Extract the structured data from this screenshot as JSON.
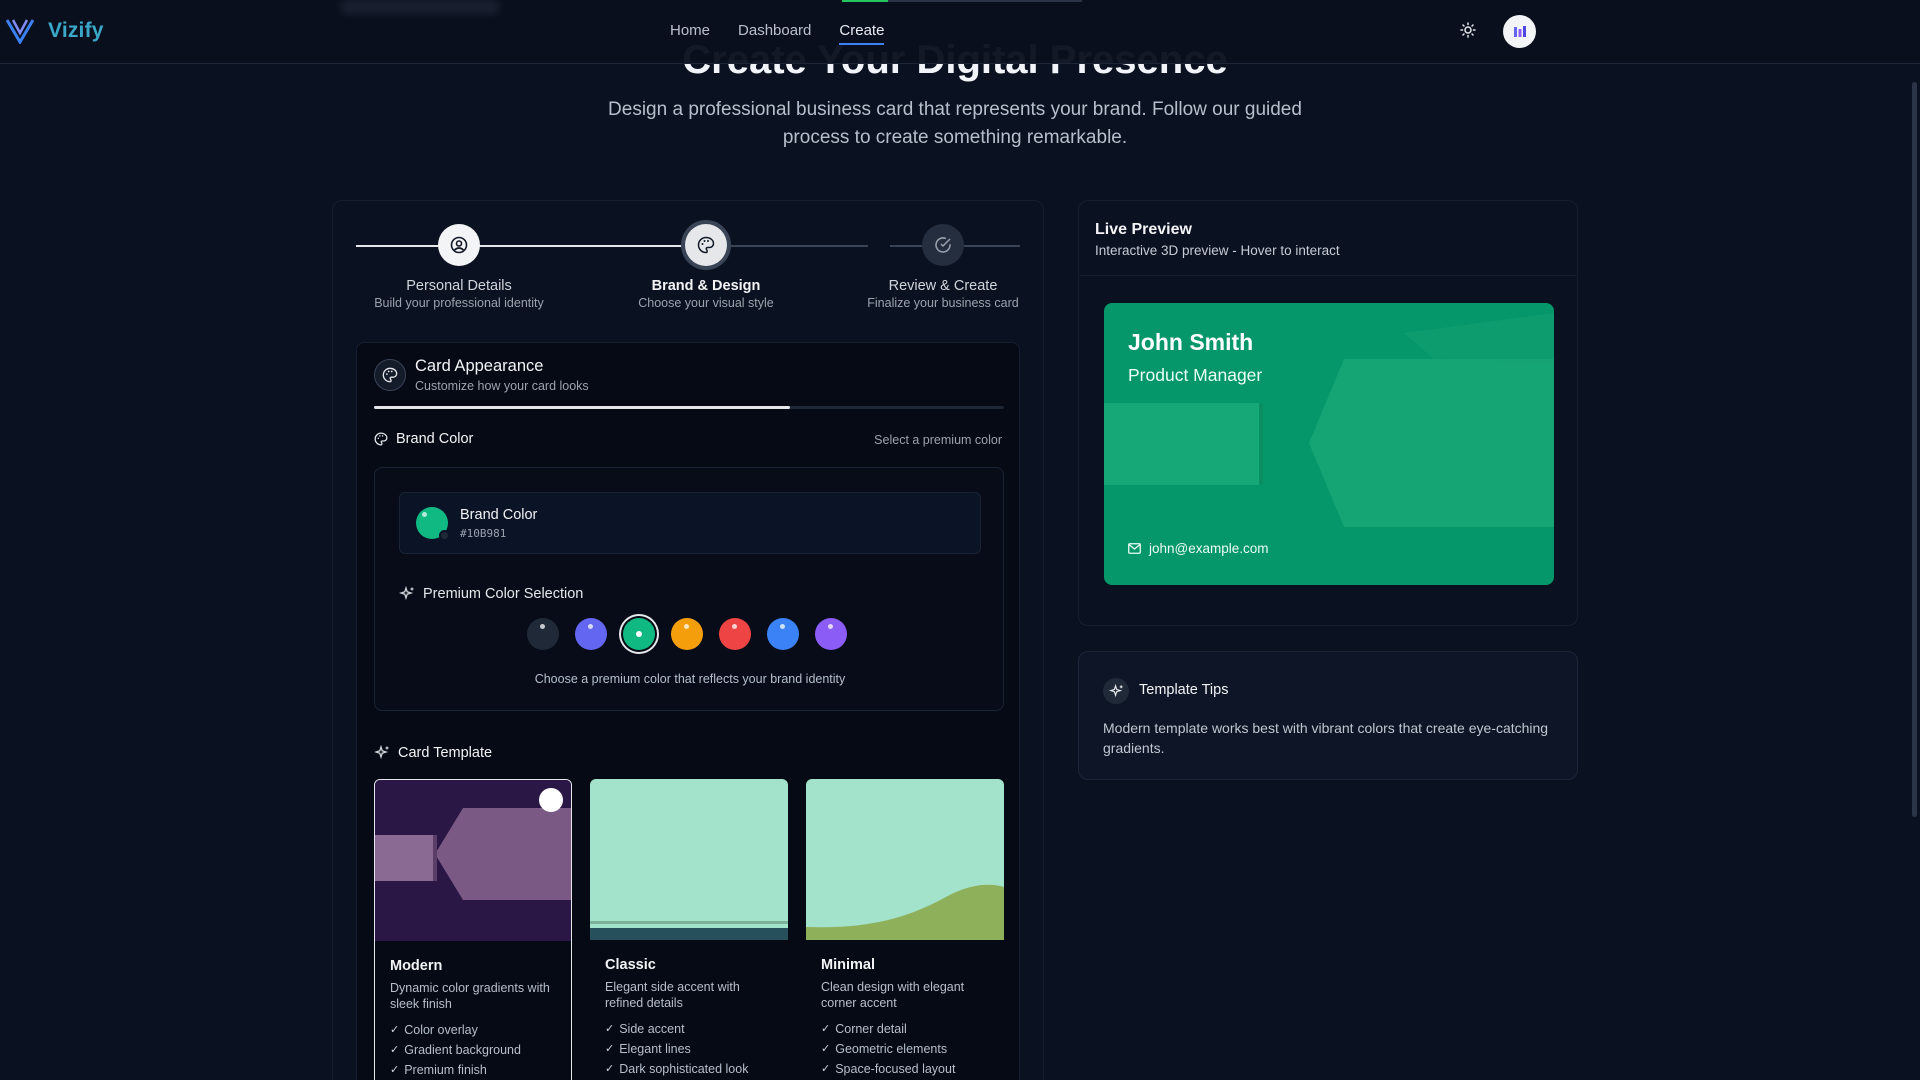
{
  "nav": {
    "brand": "Vizify",
    "links": [
      {
        "label": "Home",
        "active": false
      },
      {
        "label": "Dashboard",
        "active": false
      },
      {
        "label": "Create",
        "active": true
      }
    ],
    "theme_icon": "sun-icon",
    "avatar_icon": "avatar-logo"
  },
  "hero": {
    "title": "Create Your Digital Presence",
    "subtitle": "Design a professional business card that represents your brand. Follow our guided process to create something remarkable."
  },
  "steps": [
    {
      "title": "Personal Details",
      "desc": "Build your professional identity",
      "icon": "user-circle-icon",
      "state": "complete"
    },
    {
      "title": "Brand & Design",
      "desc": "Choose your visual style",
      "icon": "palette-icon",
      "state": "active"
    },
    {
      "title": "Review & Create",
      "desc": "Finalize your business card",
      "icon": "check-circle-icon",
      "state": "pending"
    }
  ],
  "appearance": {
    "title": "Card Appearance",
    "subtitle": "Customize how your card looks",
    "progress": 0.66
  },
  "brand_color": {
    "heading": "Brand Color",
    "hint": "Select a premium color",
    "current_label": "Brand Color",
    "current_hex": "#10B981",
    "premium_heading": "Premium Color Selection",
    "premium_hint": "Choose a premium color that reflects your brand identity",
    "swatches": [
      "#1f2937",
      "#6366f1",
      "#10b981",
      "#f59e0b",
      "#ef4444",
      "#3b82f6",
      "#8b5cf6"
    ],
    "selected_index": 2
  },
  "card_template": {
    "heading": "Card Template",
    "templates": [
      {
        "name": "Modern",
        "desc": "Dynamic color gradients with sleek finish",
        "features": [
          "Color overlay",
          "Gradient background",
          "Premium finish"
        ],
        "selected": true
      },
      {
        "name": "Classic",
        "desc": "Elegant side accent with refined details",
        "features": [
          "Side accent",
          "Elegant lines",
          "Dark sophisticated look"
        ],
        "selected": false
      },
      {
        "name": "Minimal",
        "desc": "Clean design with elegant corner accent",
        "features": [
          "Corner detail",
          "Geometric elements",
          "Space-focused layout"
        ],
        "selected": false
      }
    ]
  },
  "preview": {
    "title": "Live Preview",
    "subtitle": "Interactive 3D preview - Hover to interact",
    "card": {
      "name": "John Smith",
      "role": "Product Manager",
      "email": "john@example.com",
      "color": "#059669"
    }
  },
  "tips": {
    "title": "Template Tips",
    "text": "Modern template works best with vibrant colors that create eye-catching gradients."
  }
}
